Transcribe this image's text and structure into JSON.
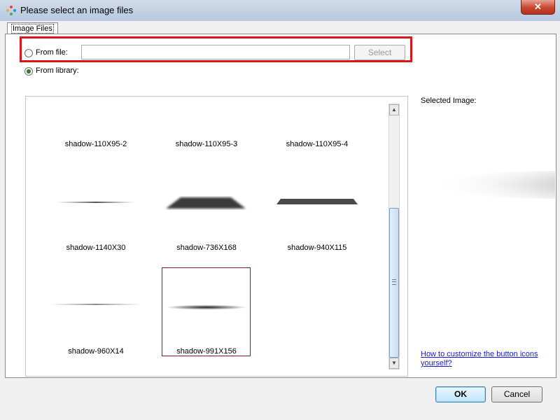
{
  "window": {
    "title": "Please select an image files",
    "close_label": "✕"
  },
  "tabs": [
    {
      "label": "Image Files"
    }
  ],
  "from_file": {
    "label": "From file:",
    "value": "",
    "selected": false,
    "select_button": "Select"
  },
  "from_library": {
    "label": "From library:",
    "selected": true
  },
  "gallery": {
    "items": [
      {
        "label": "shadow-110X95-2"
      },
      {
        "label": "shadow-110X95-3"
      },
      {
        "label": "shadow-110X95-4"
      },
      {
        "label": "shadow-1140X30"
      },
      {
        "label": "shadow-736X168"
      },
      {
        "label": "shadow-940X115"
      },
      {
        "label": "shadow-960X14"
      },
      {
        "label": "shadow-991X156",
        "selected": true
      }
    ]
  },
  "selected_image": {
    "label": "Selected Image:"
  },
  "help_link": {
    "text": "How to customize the button icons yourself?"
  },
  "buttons": {
    "ok": "OK",
    "cancel": "Cancel"
  }
}
